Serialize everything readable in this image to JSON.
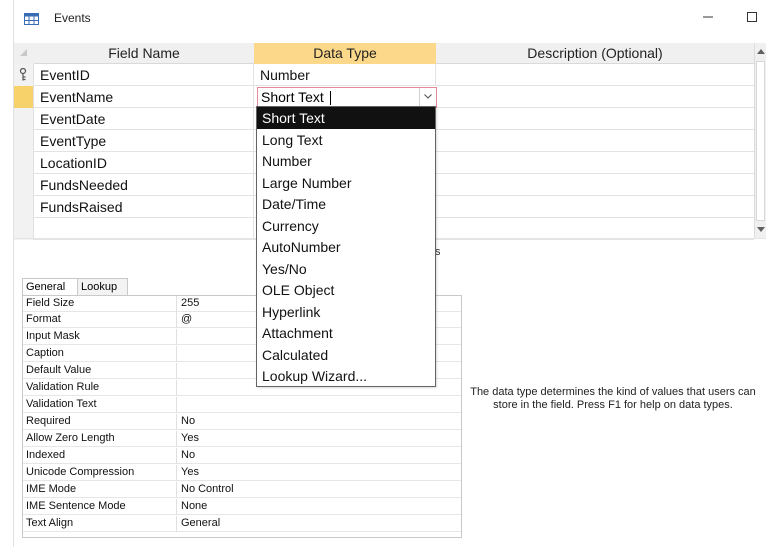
{
  "window": {
    "title": "Events"
  },
  "grid": {
    "headers": {
      "field_name": "Field Name",
      "data_type": "Data Type",
      "description": "Description (Optional)"
    },
    "rows": [
      {
        "field": "EventID",
        "type": "Number"
      },
      {
        "field": "EventName",
        "type": "Short Text"
      },
      {
        "field": "EventDate",
        "type": ""
      },
      {
        "field": "EventType",
        "type": ""
      },
      {
        "field": "LocationID",
        "type": ""
      },
      {
        "field": "FundsNeeded",
        "type": ""
      },
      {
        "field": "FundsRaised",
        "type": ""
      },
      {
        "field": "",
        "type": ""
      }
    ]
  },
  "dropdown": {
    "selected": "Short Text",
    "options": [
      "Short Text",
      "Long Text",
      "Number",
      "Large Number",
      "Date/Time",
      "Currency",
      "AutoNumber",
      "Yes/No",
      "OLE Object",
      "Hyperlink",
      "Attachment",
      "Calculated",
      "Lookup Wizard..."
    ]
  },
  "properties": {
    "tabs": {
      "general": "General",
      "lookup": "Lookup"
    },
    "rows": [
      {
        "name": "Field Size",
        "value": "255"
      },
      {
        "name": "Format",
        "value": "@"
      },
      {
        "name": "Input Mask",
        "value": ""
      },
      {
        "name": "Caption",
        "value": ""
      },
      {
        "name": "Default Value",
        "value": ""
      },
      {
        "name": "Validation Rule",
        "value": ""
      },
      {
        "name": "Validation Text",
        "value": ""
      },
      {
        "name": "Required",
        "value": "No"
      },
      {
        "name": "Allow Zero Length",
        "value": "Yes"
      },
      {
        "name": "Indexed",
        "value": "No"
      },
      {
        "name": "Unicode Compression",
        "value": "Yes"
      },
      {
        "name": "IME Mode",
        "value": "No Control"
      },
      {
        "name": "IME Sentence Mode",
        "value": "None"
      },
      {
        "name": "Text Align",
        "value": "General"
      }
    ]
  },
  "help": {
    "text": "The data type determines the kind of values that users can store in the field. Press F1 for help on data types.",
    "stray": "s"
  },
  "colors": {
    "header_highlight": "#fcd88a",
    "active_row_selector": "#f7d26a",
    "dropdown_selected_bg": "#111111"
  }
}
